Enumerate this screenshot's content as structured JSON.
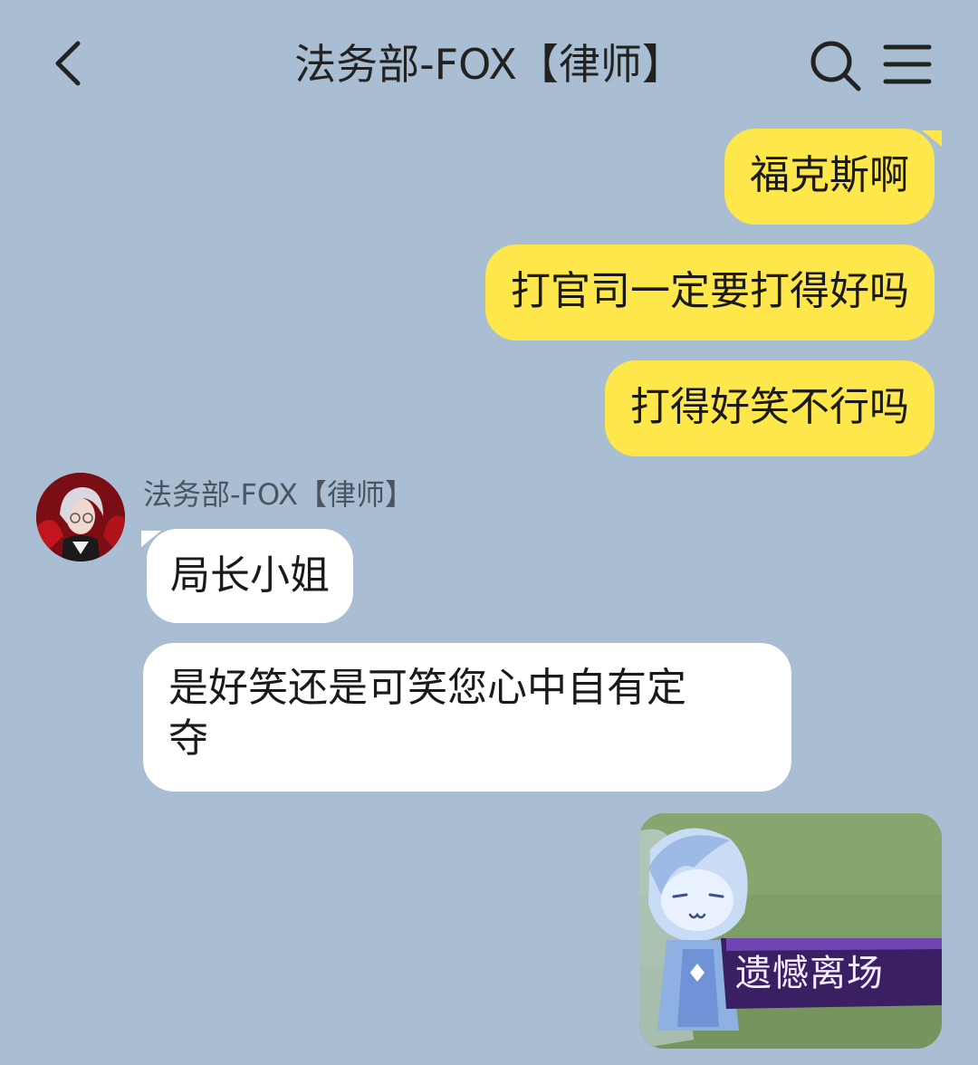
{
  "header": {
    "title": "法务部-FOX【律师】",
    "back_icon": "chevron-left-icon",
    "search_icon": "search-icon",
    "menu_icon": "menu-icon"
  },
  "messages_out": [
    {
      "text": "福克斯啊"
    },
    {
      "text": "打官司一定要打得好吗"
    },
    {
      "text": "打得好笑不行吗"
    }
  ],
  "incoming": {
    "sender_name": "法务部-FOX【律师】",
    "messages": [
      {
        "text": "局长小姐"
      },
      {
        "line1": "是好笑还是可笑您心中自有定",
        "line2": "夺"
      }
    ]
  },
  "sticker": {
    "caption": "遗憾离场"
  },
  "colors": {
    "background": "#a9bed2",
    "outgoing_bubble": "#fde74b",
    "incoming_bubble": "#ffffff",
    "sticker_banner": "#3a1f63"
  }
}
